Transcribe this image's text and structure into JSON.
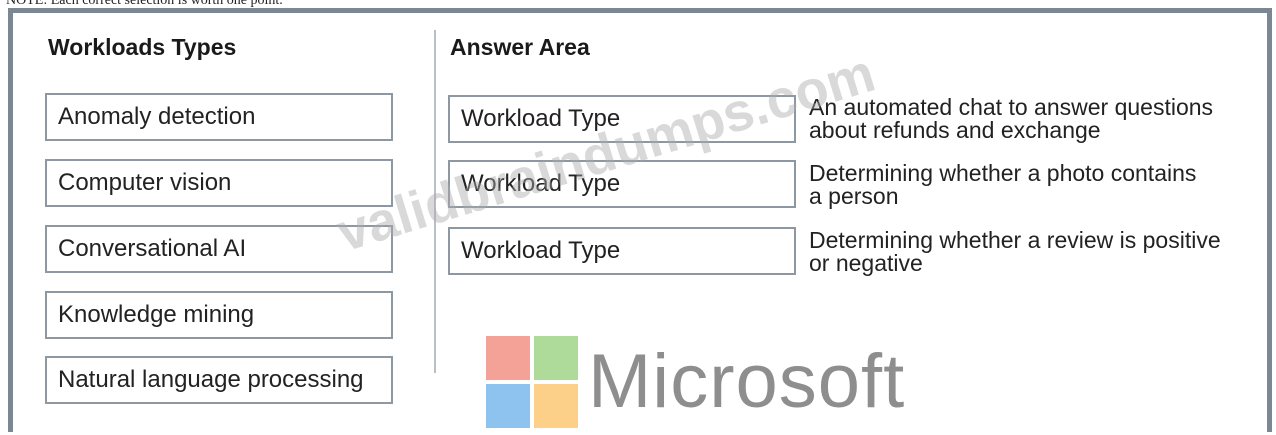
{
  "caption": "NOTE: Each correct selection is worth one point.",
  "left_panel": {
    "heading": "Workloads Types",
    "items": [
      "Anomaly detection",
      "Computer vision",
      "Conversational AI",
      "Knowledge mining",
      "Natural language processing"
    ]
  },
  "answer_area": {
    "heading": "Answer Area",
    "rows": [
      {
        "slot": "Workload Type",
        "line1": "An automated chat to answer questions",
        "line2": "about refunds and exchange"
      },
      {
        "slot": "Workload Type",
        "line1": "Determining whether a photo contains",
        "line2": "a person"
      },
      {
        "slot": "Workload Type",
        "line1": "Determining whether a review is positive",
        "line2": "or negative"
      }
    ]
  },
  "watermark": "validbraindumps.com",
  "logo": {
    "text": "Microsoft",
    "colors": {
      "red": "#f4a197",
      "green": "#aedb9a",
      "blue": "#8fc3ef",
      "yellow": "#fdd089"
    }
  },
  "colors": {
    "frame": "#7b8794",
    "box_border": "#8e98a3",
    "divider": "#b8bfc6"
  }
}
